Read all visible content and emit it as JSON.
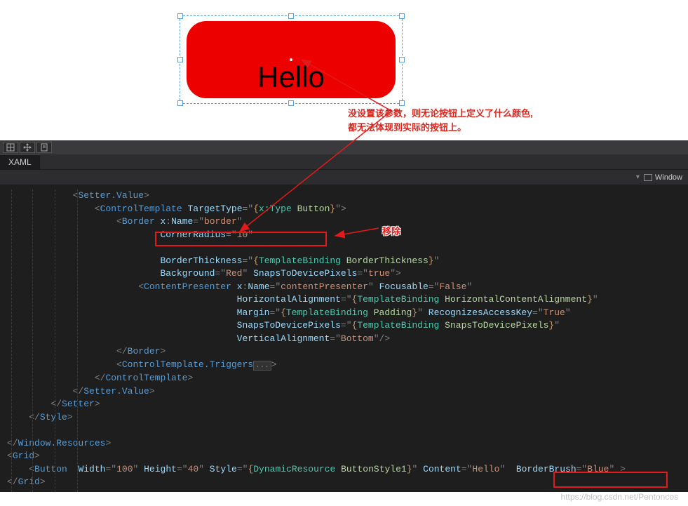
{
  "designer": {
    "button_text": "Hello"
  },
  "annotations": {
    "line1": "没设置该参数，则无论按钮上定义了什么颜色,",
    "line2": "都无法体现到实际的按钮上。",
    "remove_label": "移除"
  },
  "tabs": {
    "xaml_tab": "XAML"
  },
  "breadcrumb": {
    "window_label": "Window"
  },
  "code": {
    "l0": {
      "indent": "            ",
      "open": "<",
      "el": "Setter.Value",
      "close": ">"
    },
    "l1": {
      "indent": "                ",
      "open": "<",
      "el": "ControlTemplate",
      "sp": " ",
      "a1": "TargetType",
      "eq": "=",
      "q": "\"",
      "v1a": "{",
      "mk": "x:Type",
      "sp2": " ",
      "v1b": "Button",
      "v1c": "}",
      "close": ">"
    },
    "l2": {
      "indent": "                    ",
      "open": "<",
      "el": "Border",
      "sp": " ",
      "a1": "x",
      "col": ":",
      "a1b": "Name",
      "eq": "=",
      "q": "\"",
      "v1": "border",
      "q2": "\""
    },
    "l3": {
      "indent": "                            ",
      "a": "CornerRadius",
      "eq": "=",
      "q": "\"",
      "v": "10",
      "q2": "\""
    },
    "l4": {
      "indent": ""
    },
    "l5": {
      "indent": "                            ",
      "a": "BorderThickness",
      "eq": "=",
      "q": "\"",
      "v1": "{",
      "mk": "TemplateBinding",
      "sp": " ",
      "v2": "BorderThickness",
      "v3": "}",
      "q2": "\""
    },
    "l6": {
      "indent": "                            ",
      "a": "Background",
      "eq": "=",
      "q": "\"",
      "v": "Red",
      "q2": "\"",
      "sp": " ",
      "a2": "SnapsToDevicePixels",
      "eq2": "=",
      "q3": "\"",
      "v2": "true",
      "q4": "\"",
      "close": ">"
    },
    "l7": {
      "indent": "                        ",
      "open": "<",
      "el": "ContentPresenter",
      "sp": " ",
      "a": "x",
      "col": ":",
      "ab": "Name",
      "eq": "=",
      "q": "\"",
      "v": "contentPresenter",
      "q2": "\"",
      "sp2": " ",
      "a2": "Focusable",
      "eq2": "=",
      "q3": "\"",
      "v2": "False",
      "q4": "\""
    },
    "l8": {
      "indent": "                                          ",
      "a": "HorizontalAlignment",
      "eq": "=",
      "q": "\"",
      "v1": "{",
      "mk": "TemplateBinding",
      "sp": " ",
      "v2": "HorizontalContentAlignment",
      "v3": "}",
      "q2": "\""
    },
    "l9": {
      "indent": "                                          ",
      "a": "Margin",
      "eq": "=",
      "q": "\"",
      "v1": "{",
      "mk": "TemplateBinding",
      "sp": " ",
      "v2": "Padding",
      "v3": "}",
      "q2": "\"",
      "sp2": " ",
      "a2": "RecognizesAccessKey",
      "eq2": "=",
      "q3": "\"",
      "v4": "True",
      "q4": "\""
    },
    "l10": {
      "indent": "                                          ",
      "a": "SnapsToDevicePixels",
      "eq": "=",
      "q": "\"",
      "v1": "{",
      "mk": "TemplateBinding",
      "sp": " ",
      "v2": "SnapsToDevicePixels",
      "v3": "}",
      "q2": "\""
    },
    "l11": {
      "indent": "                                          ",
      "a": "VerticalAlignment",
      "eq": "=",
      "q": "\"",
      "v": "Bottom",
      "q2": "\"",
      "close": "/>"
    },
    "l12": {
      "indent": "                    ",
      "open": "</",
      "el": "Border",
      "close": ">"
    },
    "l13": {
      "indent": "                    ",
      "open": "<",
      "el": "ControlTemplate.Triggers",
      "box": "...",
      "close": ">"
    },
    "l14": {
      "indent": "                ",
      "open": "</",
      "el": "ControlTemplate",
      "close": ">"
    },
    "l15": {
      "indent": "            ",
      "open": "</",
      "el": "Setter.Value",
      "close": ">"
    },
    "l16": {
      "indent": "        ",
      "open": "</",
      "el": "Setter",
      "close": ">"
    },
    "l17": {
      "indent": "    ",
      "open": "</",
      "el": "Style",
      "close": ">"
    },
    "l18": {
      "indent": ""
    },
    "l19": {
      "indent": "",
      "open": "</",
      "el": "Window.Resources",
      "close": ">"
    },
    "l20": {
      "indent": "",
      "open": "<",
      "el": "Grid",
      "close": ">"
    },
    "l21": {
      "indent": "    ",
      "open": "<",
      "el": "Button",
      "sp": "  ",
      "a1": "Width",
      "eq": "=",
      "q": "\"",
      "v1": "100",
      "q2": "\"",
      "sp2": " ",
      "a2": "Height",
      "eq2": "=",
      "q3": "\"",
      "v2": "40",
      "q4": "\"",
      "sp3": " ",
      "a3": "Style",
      "eq3": "=",
      "q5": "\"",
      "v3a": "{",
      "mk": "DynamicResource",
      "sp4": " ",
      "v3b": "ButtonStyle1",
      "v3c": "}",
      "q6": "\"",
      "sp5": " ",
      "a4": "Content",
      "eq4": "=",
      "q7": "\"",
      "v4": "Hello",
      "q8": "\"",
      "sp6": "  ",
      "a5": "BorderBrush",
      "eq5": "=",
      "q9": "\"",
      "v5": "Blue",
      "q10": "\"",
      "sp7": " ",
      "close": ">"
    },
    "l22": {
      "indent": "",
      "open": "</",
      "el": "Grid",
      "close": ">"
    }
  },
  "watermark": "https://blog.csdn.net/Pentoncos"
}
